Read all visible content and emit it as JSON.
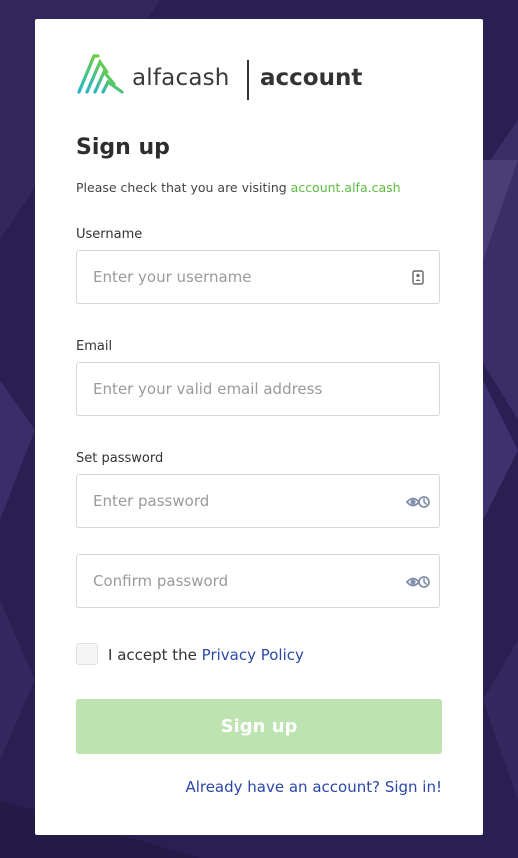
{
  "brand": {
    "name": "alfacash",
    "product": "account",
    "colors": {
      "green": "#5cbd3e",
      "teal": "#2ab5c4",
      "purple_bg": "#2a1f52"
    }
  },
  "form": {
    "title": "Sign up",
    "notice_text": "Please check that you are visiting ",
    "notice_link": "account.alfa.cash",
    "username": {
      "label": "Username",
      "placeholder": "Enter your username",
      "icon": "contact-card-icon"
    },
    "email": {
      "label": "Email",
      "placeholder": "Enter your valid email address"
    },
    "password": {
      "label": "Set password",
      "placeholder": "Enter password",
      "icon": "eye-icon"
    },
    "confirm_password": {
      "placeholder": "Confirm password",
      "icon": "eye-icon"
    },
    "accept_text": "I accept the ",
    "accept_link": "Privacy Policy",
    "accept_checked": false,
    "submit_label": "Sign up",
    "signin_link": "Already have an account? Sign in!"
  }
}
